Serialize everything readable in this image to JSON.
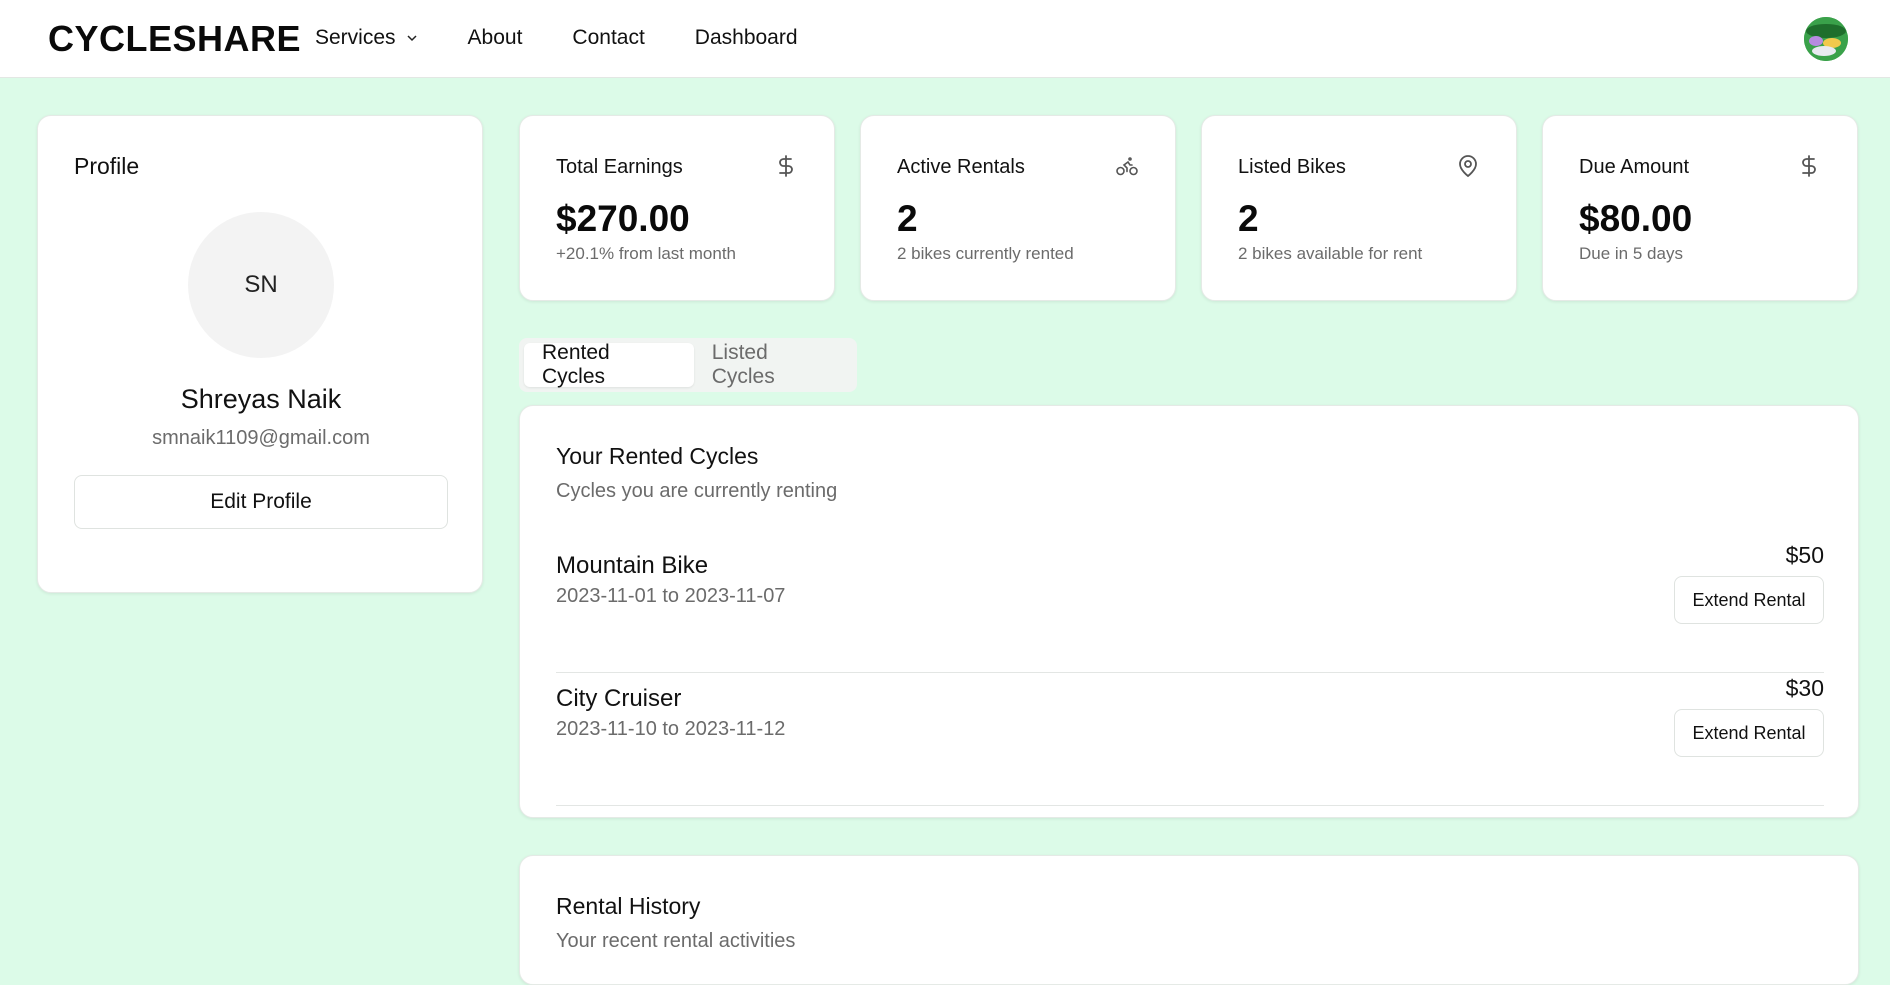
{
  "header": {
    "brand": "CYCLESHARE",
    "nav": [
      "Services",
      "About",
      "Contact",
      "Dashboard"
    ]
  },
  "profile": {
    "title": "Profile",
    "initials": "SN",
    "name": "Shreyas Naik",
    "email": "smnaik1109@gmail.com",
    "edit_label": "Edit Profile"
  },
  "stats": [
    {
      "title": "Total Earnings",
      "value": "$270.00",
      "sub": "+20.1% from last month",
      "icon": "dollar-icon"
    },
    {
      "title": "Active Rentals",
      "value": "2",
      "sub": "2 bikes currently rented",
      "icon": "bike-icon"
    },
    {
      "title": "Listed Bikes",
      "value": "2",
      "sub": "2 bikes available for rent",
      "icon": "map-pin-icon"
    },
    {
      "title": "Due Amount",
      "value": "$80.00",
      "sub": "Due in 5 days",
      "icon": "dollar-icon"
    }
  ],
  "tabs": [
    "Rented Cycles",
    "Listed Cycles"
  ],
  "rented": {
    "title": "Your Rented Cycles",
    "subtitle": "Cycles you are currently renting",
    "items": [
      {
        "name": "Mountain Bike",
        "dates": "2023-11-01 to 2023-11-07",
        "price": "$50",
        "action": "Extend Rental"
      },
      {
        "name": "City Cruiser",
        "dates": "2023-11-10 to 2023-11-12",
        "price": "$30",
        "action": "Extend Rental"
      }
    ]
  },
  "history": {
    "title": "Rental History",
    "subtitle": "Your recent rental activities"
  },
  "colors": {
    "background": "#dcfbe8",
    "card": "#ffffff",
    "muted_text": "#6b6b6b"
  }
}
